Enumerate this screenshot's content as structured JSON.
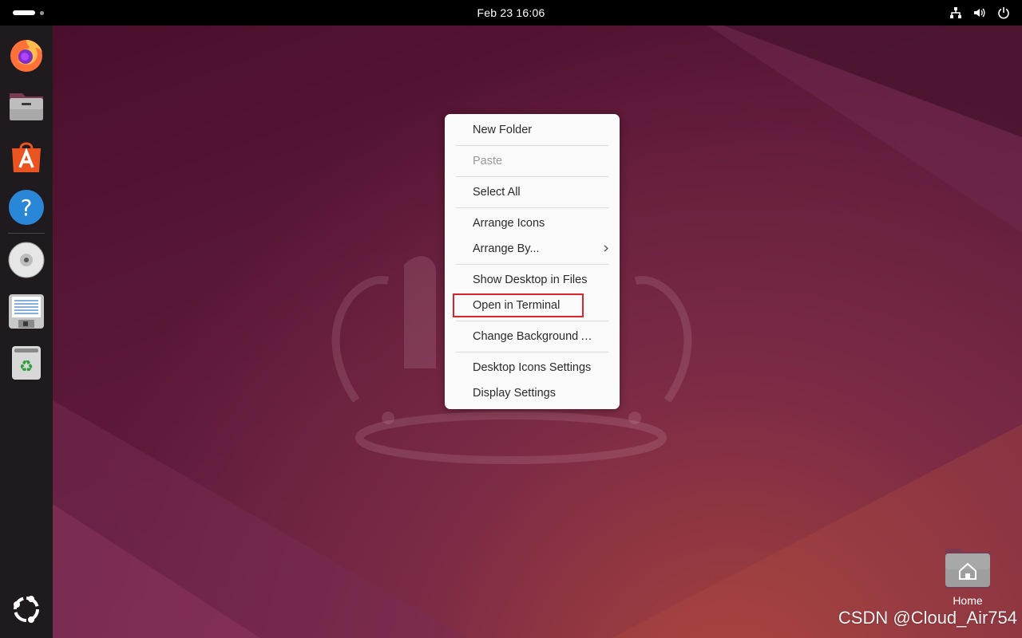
{
  "topbar": {
    "clock": "Feb 23  16:06",
    "tray": [
      "network-icon",
      "volume-icon",
      "power-icon"
    ]
  },
  "dock": {
    "items": [
      {
        "name": "firefox-icon"
      },
      {
        "name": "files-icon"
      },
      {
        "name": "app-center-icon"
      },
      {
        "name": "help-icon"
      },
      {
        "name": "dvd-icon"
      },
      {
        "name": "text-editor-icon"
      },
      {
        "name": "trash-icon"
      }
    ],
    "show_apps": "ubuntu-logo-icon"
  },
  "context_menu": {
    "items": [
      {
        "label": "New Folder",
        "enabled": true
      },
      {
        "label": "Paste",
        "enabled": false
      },
      {
        "label": "Select All",
        "enabled": true
      },
      {
        "label": "Arrange Icons",
        "enabled": true
      },
      {
        "label": "Arrange By...",
        "enabled": true,
        "submenu": true
      },
      {
        "label": "Show Desktop in Files",
        "enabled": true
      },
      {
        "label": "Open in Terminal",
        "enabled": true,
        "highlighted": true
      },
      {
        "label": "Change Background …",
        "enabled": true
      },
      {
        "label": "Desktop Icons Settings",
        "enabled": true
      },
      {
        "label": "Display Settings",
        "enabled": true
      }
    ]
  },
  "desktop": {
    "home_label": "Home",
    "watermark": "CSDN @Cloud_Air754"
  },
  "colors": {
    "highlight_border": "#d9262c",
    "dock_bg": "#1e1a1d",
    "wallpaper_base": "#5e1b3c"
  }
}
